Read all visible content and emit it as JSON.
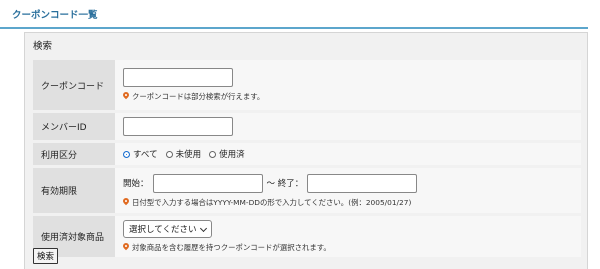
{
  "header": {
    "title": "クーポンコード一覧"
  },
  "search_panel": {
    "title": "検索",
    "fields": {
      "coupon_code": {
        "label": "クーポンコード",
        "value": "",
        "hint": "クーポンコードは部分検索が行えます。"
      },
      "member_id": {
        "label": "メンバーID",
        "value": ""
      },
      "usage": {
        "label": "利用区分",
        "options": [
          "すべて",
          "未使用",
          "使用済"
        ],
        "selected": "すべて"
      },
      "validity": {
        "label": "有効期限",
        "start_label": "開始：",
        "start_value": "",
        "separator": "〜 終了：",
        "end_value": "",
        "hint": "日付型で入力する場合はYYYY-MM-DDの形で入力してください。(例：2005/01/27)"
      },
      "target_product": {
        "label": "使用済対象商品",
        "selected": "選択してください",
        "hint": "対象商品を含む履歴を持つクーポンコードが選択されます。"
      }
    },
    "submit_label": "検索"
  },
  "colors": {
    "header_text": "#2a6f9c",
    "header_rule": "#5ca6cc",
    "hint_icon": "#e06a20",
    "radio_selected": "#1a6fd0"
  },
  "icons": {
    "hint": "pin-icon",
    "select": "chevron-down-icon"
  }
}
